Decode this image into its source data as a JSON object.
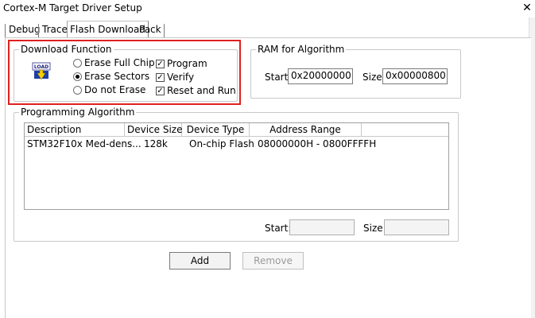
{
  "window": {
    "title": "Cortex-M Target Driver Setup",
    "close_glyph": "✕"
  },
  "tabs": [
    {
      "label": "Debug",
      "active": false
    },
    {
      "label": "Trace",
      "active": false
    },
    {
      "label": "Flash Download",
      "active": true
    },
    {
      "label": "Pack",
      "active": false
    }
  ],
  "download_function": {
    "legend": "Download Function",
    "icon": "load-icon",
    "icon_text": "LOAD",
    "radios": [
      {
        "label": "Erase Full Chip",
        "checked": false
      },
      {
        "label": "Erase Sectors",
        "checked": true
      },
      {
        "label": "Do not Erase",
        "checked": false
      }
    ],
    "checkboxes": [
      {
        "label": "Program",
        "checked": true
      },
      {
        "label": "Verify",
        "checked": true
      },
      {
        "label": "Reset and Run",
        "checked": true
      }
    ]
  },
  "ram_for_algorithm": {
    "legend": "RAM for Algorithm",
    "start_label": "Start:",
    "start_value": "0x20000000",
    "size_label": "Size:",
    "size_value": "0x00000800"
  },
  "programming_algorithm": {
    "legend": "Programming Algorithm",
    "columns": [
      "Description",
      "Device Size",
      "Device Type",
      "Address Range"
    ],
    "rows": [
      [
        "STM32F10x Med-dens...",
        "128k",
        "On-chip Flash",
        "08000000H - 0800FFFFH"
      ]
    ],
    "start_label": "Start:",
    "start_value": "",
    "size_label": "Size:",
    "size_value": ""
  },
  "buttons": {
    "add": "Add",
    "remove": "Remove"
  },
  "colors": {
    "highlight": "#e02020",
    "border": "#c8c8c8"
  }
}
